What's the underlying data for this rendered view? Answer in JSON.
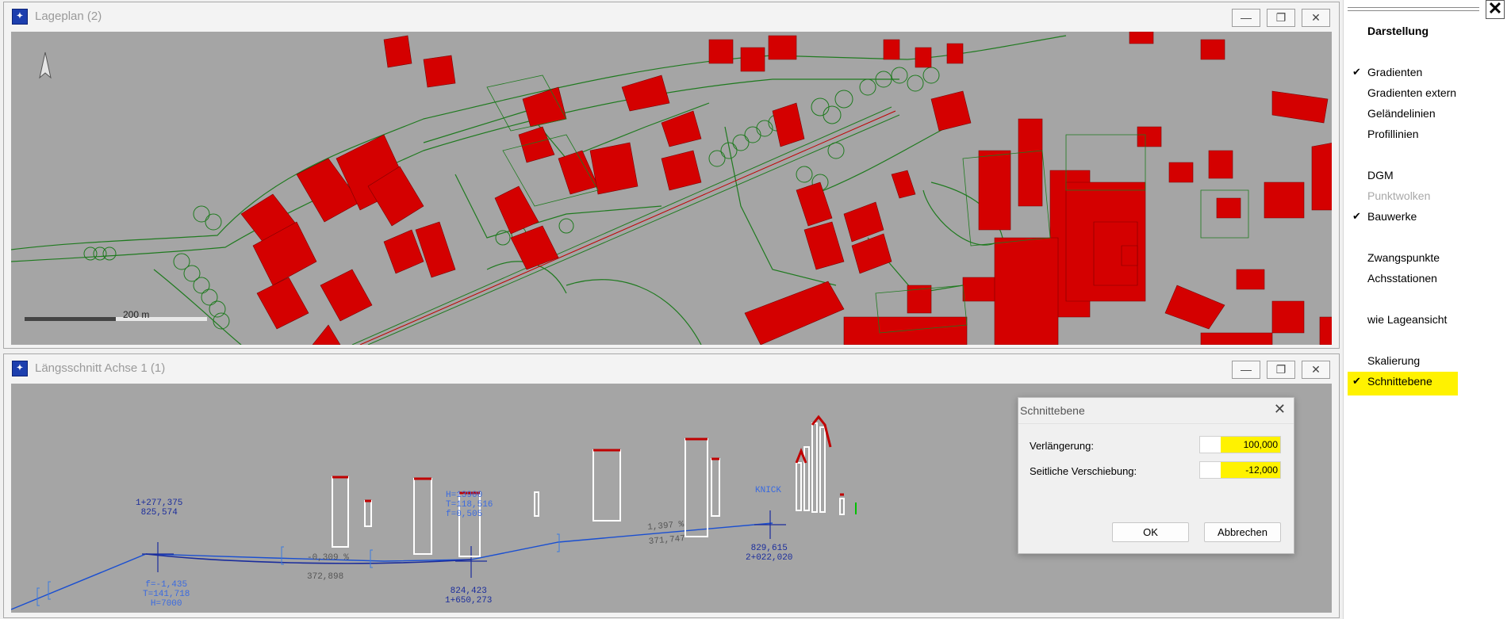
{
  "lageplan": {
    "title": "Lageplan (2)",
    "scale_label": "200 m",
    "buttons": {
      "minimize": "—",
      "maximize": "❐",
      "close": "✕"
    }
  },
  "laengsschnitt": {
    "title": "Längsschnitt Achse 1 (1)",
    "buttons": {
      "minimize": "—",
      "maximize": "❐",
      "close": "✕"
    },
    "annotations": {
      "st1_station": "1+277,375",
      "st1_height": "825,574",
      "f1": "f=-1,435",
      "t1": "T=141,718",
      "h1": "H=7000",
      "grade1": "-0,309 %",
      "len1": "372,898",
      "h2": "H=13900",
      "t2": "T=118,516",
      "f2": "f=0,505",
      "st2_height": "824,423",
      "st2_station": "1+650,273",
      "grade2": "1,397 %",
      "len2": "371,747",
      "knick": "KNICK",
      "st3_height": "829,615",
      "st3_station": "2+022,020"
    }
  },
  "dialog": {
    "title": "Schnittebene",
    "close_glyph": "✕",
    "field1_label": "Verlängerung:",
    "field1_value": "100,000",
    "field2_label": "Seitliche Verschiebung:",
    "field2_value": "-12,000",
    "ok_label": "OK",
    "cancel_label": "Abbrechen"
  },
  "sidepanel": {
    "close_glyph": "✕",
    "header": "Darstellung",
    "items": [
      {
        "label": "Gradienten",
        "checked": true,
        "disabled": false
      },
      {
        "label": "Gradienten extern",
        "checked": false,
        "disabled": false
      },
      {
        "label": "Geländelinien",
        "checked": false,
        "disabled": false
      },
      {
        "label": "Profillinien",
        "checked": false,
        "disabled": false
      },
      {
        "label": "DGM",
        "checked": false,
        "disabled": false
      },
      {
        "label": "Punktwolken",
        "checked": false,
        "disabled": true
      },
      {
        "label": "Bauwerke",
        "checked": true,
        "disabled": false
      },
      {
        "label": "Zwangspunkte",
        "checked": false,
        "disabled": false
      },
      {
        "label": "Achsstationen",
        "checked": false,
        "disabled": false
      },
      {
        "label": "wie Lageansicht",
        "checked": false,
        "disabled": false
      },
      {
        "label": "Skalierung",
        "checked": false,
        "disabled": false
      },
      {
        "label": "Schnittebene",
        "checked": true,
        "disabled": false
      }
    ],
    "check_glyph": "✔",
    "highlight_color": "#fff200"
  },
  "colors": {
    "building": "#d40000",
    "outline": "#1f7a1f",
    "axis": "#1a4fd1",
    "canvas": "#a5a5a5"
  }
}
